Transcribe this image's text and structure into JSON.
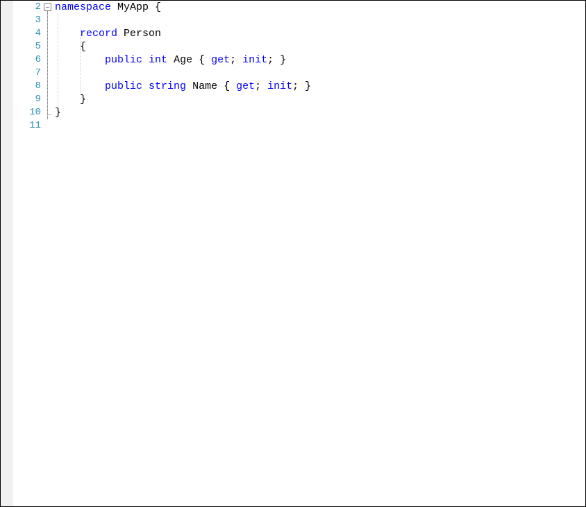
{
  "colors": {
    "keyword": "#0000ff",
    "lineNumber": "#2b91af",
    "text": "#000000",
    "foldBorder": "#808080"
  },
  "lines": [
    {
      "num": 2,
      "indent": 0,
      "foldBox": true,
      "tokens": [
        {
          "t": "namespace",
          "cls": "kw"
        },
        {
          "t": " ",
          "cls": "punct"
        },
        {
          "t": "MyApp {",
          "cls": "ident"
        }
      ]
    },
    {
      "num": 3,
      "indent": 0,
      "tokens": []
    },
    {
      "num": 4,
      "indent": 1,
      "tokens": [
        {
          "t": "record",
          "cls": "kw"
        },
        {
          "t": " ",
          "cls": "punct"
        },
        {
          "t": "Person",
          "cls": "typename"
        }
      ]
    },
    {
      "num": 5,
      "indent": 1,
      "tokens": [
        {
          "t": "{",
          "cls": "punct"
        }
      ]
    },
    {
      "num": 6,
      "indent": 2,
      "tokens": [
        {
          "t": "public",
          "cls": "kw"
        },
        {
          "t": " ",
          "cls": "punct"
        },
        {
          "t": "int",
          "cls": "type"
        },
        {
          "t": " Age { ",
          "cls": "ident"
        },
        {
          "t": "get",
          "cls": "kw"
        },
        {
          "t": "; ",
          "cls": "punct"
        },
        {
          "t": "init",
          "cls": "kw"
        },
        {
          "t": "; }",
          "cls": "punct"
        }
      ]
    },
    {
      "num": 7,
      "indent": 0,
      "tokens": []
    },
    {
      "num": 8,
      "indent": 2,
      "tokens": [
        {
          "t": "public",
          "cls": "kw"
        },
        {
          "t": " ",
          "cls": "punct"
        },
        {
          "t": "string",
          "cls": "type"
        },
        {
          "t": " Name { ",
          "cls": "ident"
        },
        {
          "t": "get",
          "cls": "kw"
        },
        {
          "t": "; ",
          "cls": "punct"
        },
        {
          "t": "init",
          "cls": "kw"
        },
        {
          "t": "; }",
          "cls": "punct"
        }
      ]
    },
    {
      "num": 9,
      "indent": 1,
      "tokens": [
        {
          "t": "}",
          "cls": "punct"
        }
      ]
    },
    {
      "num": 10,
      "indent": 0,
      "tokens": [
        {
          "t": "}",
          "cls": "punct"
        }
      ]
    },
    {
      "num": 11,
      "indent": 0,
      "pencil": true,
      "tokens": []
    }
  ],
  "indentUnit": "    "
}
